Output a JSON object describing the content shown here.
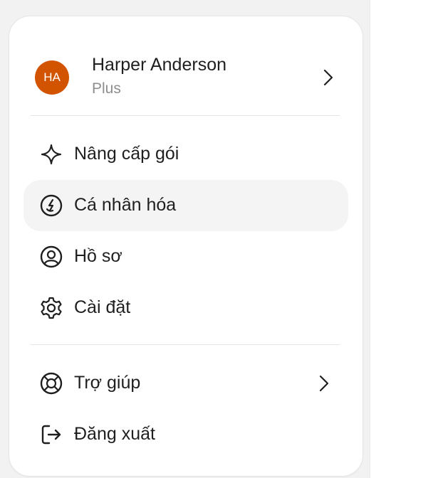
{
  "profile": {
    "initials": "HA",
    "name": "Harper Anderson",
    "plan": "Plus"
  },
  "menu": {
    "upgrade": {
      "label": "Nâng cấp gói",
      "icon": "sparkle-icon"
    },
    "personalize": {
      "label": "Cá nhân hóa",
      "icon": "personalize-icon"
    },
    "profile": {
      "label": "Hồ sơ",
      "icon": "user-circle-icon"
    },
    "settings": {
      "label": "Cài đặt",
      "icon": "gear-icon"
    },
    "help": {
      "label": "Trợ giúp",
      "icon": "lifebuoy-icon"
    },
    "logout": {
      "label": "Đăng xuất",
      "icon": "logout-icon"
    }
  },
  "colors": {
    "avatar_bg": "#d35400",
    "active_item_bg": "#f4f4f4",
    "text": "#1f1f1f",
    "muted": "#8e8e8e"
  }
}
